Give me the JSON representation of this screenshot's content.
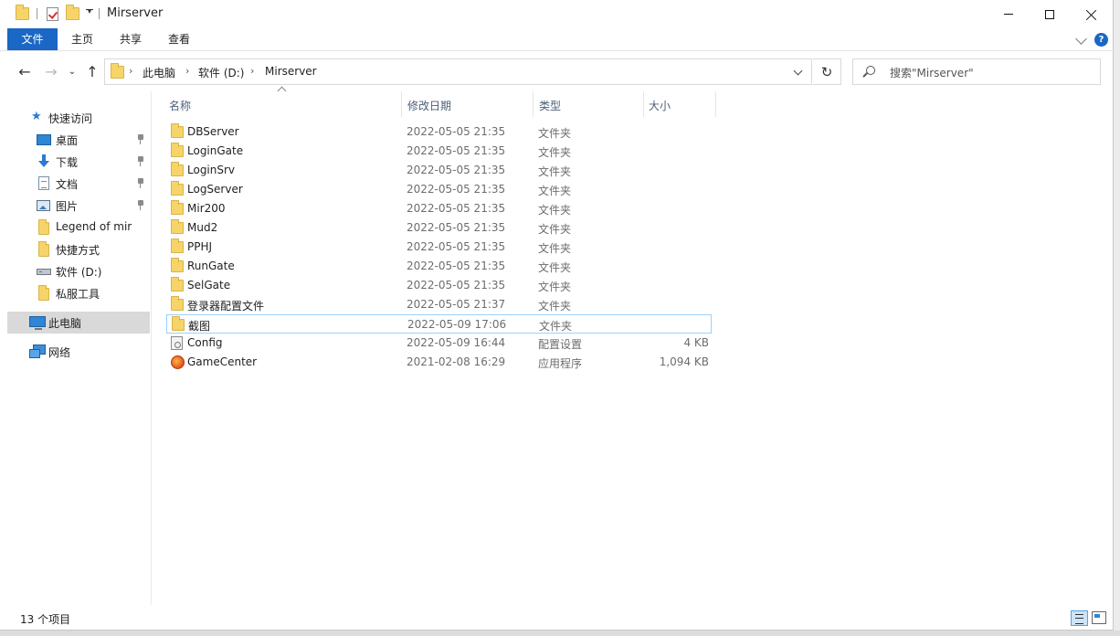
{
  "window": {
    "title": "Mirserver"
  },
  "ribbon": {
    "tabs": [
      "文件",
      "主页",
      "共享",
      "查看"
    ]
  },
  "address": {
    "crumbs": [
      "此电脑",
      "软件 (D:)",
      "Mirserver"
    ]
  },
  "search": {
    "placeholder": "搜索\"Mirserver\""
  },
  "nav": {
    "quick_access": "快速访问",
    "items": [
      {
        "label": "桌面",
        "icon": "desktop-icon",
        "pinned": true
      },
      {
        "label": "下载",
        "icon": "download-icon",
        "pinned": true
      },
      {
        "label": "文档",
        "icon": "document-icon",
        "pinned": true
      },
      {
        "label": "图片",
        "icon": "picture-icon",
        "pinned": true
      },
      {
        "label": "Legend of mir",
        "icon": "folder-icon",
        "pinned": false
      },
      {
        "label": "快捷方式",
        "icon": "folder-icon",
        "pinned": false
      },
      {
        "label": "软件 (D:)",
        "icon": "drive-icon",
        "pinned": false
      },
      {
        "label": "私服工具",
        "icon": "folder-icon",
        "pinned": false
      }
    ],
    "this_pc": "此电脑",
    "network": "网络"
  },
  "columns": {
    "name": "名称",
    "date": "修改日期",
    "type": "类型",
    "size": "大小"
  },
  "files": [
    {
      "name": "DBServer",
      "date": "2022-05-05 21:35",
      "type": "文件夹",
      "size": "",
      "icon": "folder-icon"
    },
    {
      "name": "LoginGate",
      "date": "2022-05-05 21:35",
      "type": "文件夹",
      "size": "",
      "icon": "folder-icon"
    },
    {
      "name": "LoginSrv",
      "date": "2022-05-05 21:35",
      "type": "文件夹",
      "size": "",
      "icon": "folder-icon"
    },
    {
      "name": "LogServer",
      "date": "2022-05-05 21:35",
      "type": "文件夹",
      "size": "",
      "icon": "folder-icon"
    },
    {
      "name": "Mir200",
      "date": "2022-05-05 21:35",
      "type": "文件夹",
      "size": "",
      "icon": "folder-icon"
    },
    {
      "name": "Mud2",
      "date": "2022-05-05 21:35",
      "type": "文件夹",
      "size": "",
      "icon": "folder-icon"
    },
    {
      "name": "PPHJ",
      "date": "2022-05-05 21:35",
      "type": "文件夹",
      "size": "",
      "icon": "folder-icon"
    },
    {
      "name": "RunGate",
      "date": "2022-05-05 21:35",
      "type": "文件夹",
      "size": "",
      "icon": "folder-icon"
    },
    {
      "name": "SelGate",
      "date": "2022-05-05 21:35",
      "type": "文件夹",
      "size": "",
      "icon": "folder-icon"
    },
    {
      "name": "登录器配置文件",
      "date": "2022-05-05 21:37",
      "type": "文件夹",
      "size": "",
      "icon": "folder-icon"
    },
    {
      "name": "截图",
      "date": "2022-05-09 17:06",
      "type": "文件夹",
      "size": "",
      "icon": "folder-icon"
    },
    {
      "name": "Config",
      "date": "2022-05-09 16:44",
      "type": "配置设置",
      "size": "4 KB",
      "icon": "config-file-icon"
    },
    {
      "name": "GameCenter",
      "date": "2021-02-08 16:29",
      "type": "应用程序",
      "size": "1,094 KB",
      "icon": "application-icon"
    }
  ],
  "status": {
    "count": "13 个项目"
  },
  "colors": {
    "accent": "#1a67c5",
    "folder": "#f6d46a",
    "highlight_border": "#99d1ff"
  }
}
